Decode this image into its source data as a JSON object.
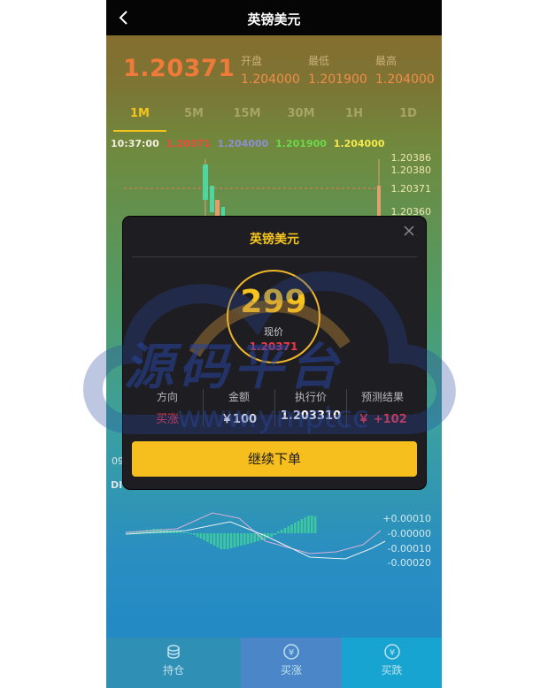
{
  "header": {
    "title": "英镑美元"
  },
  "quote": {
    "price": "1.20371",
    "stats": [
      {
        "label": "开盘",
        "value": "1.204000"
      },
      {
        "label": "最低",
        "value": "1.201900"
      },
      {
        "label": "最高",
        "value": "1.204000"
      }
    ]
  },
  "periods": [
    {
      "label": "1M",
      "active": true
    },
    {
      "label": "5M",
      "active": false
    },
    {
      "label": "15M",
      "active": false
    },
    {
      "label": "30M",
      "active": false
    },
    {
      "label": "1H",
      "active": false
    },
    {
      "label": "1D",
      "active": false
    }
  ],
  "ohlc_legend": {
    "time": "10:37:00",
    "values": [
      "1.20371",
      "1.204000",
      "1.201900",
      "1.204000"
    ]
  },
  "price_axis": [
    "1.20386",
    "1.20380",
    "1.20371",
    "1.20360"
  ],
  "partial_labels": {
    "time_fragment": "09",
    "indicator_fragment": "DI"
  },
  "macd_axis": [
    "+0.00010",
    "-0.00000",
    "-0.00010",
    "-0.00020"
  ],
  "modal": {
    "title": "英镑美元",
    "countdown": "299",
    "current_price_label": "现价",
    "current_price": "1.20371",
    "columns": [
      {
        "header": "方向",
        "value": "买涨"
      },
      {
        "header": "金额",
        "value": "￥100"
      },
      {
        "header": "执行价",
        "value": "1.203310"
      },
      {
        "header": "预测结果",
        "value": "￥ +102"
      }
    ],
    "continue_label": "继续下单"
  },
  "bottom_bar": [
    {
      "label": "持仓",
      "icon": "coins-icon"
    },
    {
      "label": "买涨",
      "icon": "yen-up-icon"
    },
    {
      "label": "买跌",
      "icon": "yen-down-icon"
    }
  ],
  "watermark": {
    "text": "源码平台",
    "url": "www.ymptcc"
  },
  "colors": {
    "accent": "#f5c41e",
    "up": "#f03a4a",
    "price": "#f07a3a",
    "modal_bg": "#1e1e22"
  }
}
